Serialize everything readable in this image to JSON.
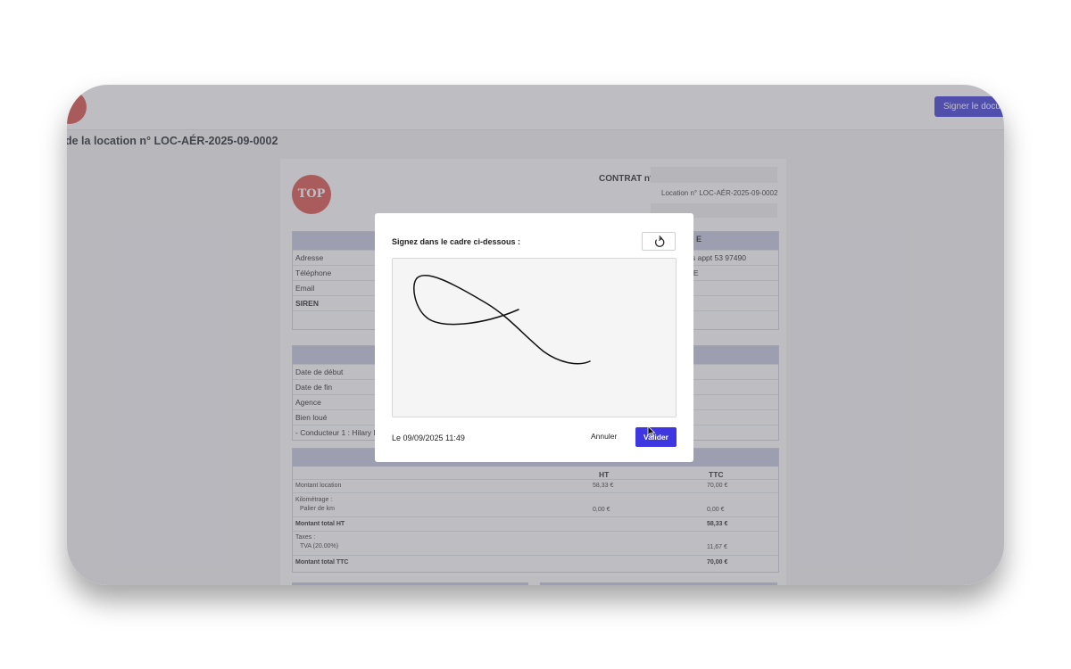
{
  "header": {
    "sign_document_label": "Signer le docu"
  },
  "page": {
    "title": "de la location n° LOC-AÉR-2025-09-0002"
  },
  "document": {
    "logo_text": "TOP",
    "contract_label": "CONTRAT n°",
    "location_ref": "Location n° LOC-AÉR-2025-09-0002",
    "client_head_fragment": "E",
    "company": {
      "rows": [
        {
          "label": "Adresse",
          "value": "ves appt 53 97490"
        },
        {
          "label": "Téléphone",
          "value": "LDE"
        },
        {
          "label": "Email",
          "value": ""
        },
        {
          "label": "SIREN",
          "value": ""
        }
      ]
    },
    "rental": {
      "rows": [
        {
          "label": "Date de début"
        },
        {
          "label": "Date de fin"
        },
        {
          "label": "Agence"
        },
        {
          "label": "Bien loué"
        },
        {
          "label": "- Conducteur 1 : Hilary D"
        }
      ]
    },
    "pricing": {
      "ht_header": "HT",
      "ttc_header": "TTC",
      "rows": [
        {
          "label": "Montant location",
          "ht": "58,33 €",
          "ttc": "70,00 €"
        },
        {
          "label": "Kilométrage :",
          "ht": "",
          "ttc": ""
        },
        {
          "label": "Palier de km",
          "ht": "0,00 €",
          "ttc": "0,00 €"
        },
        {
          "label": "Montant total HT",
          "ht": "",
          "ttc": "58,33 €"
        },
        {
          "label": "Taxes :",
          "ht": "",
          "ttc": ""
        },
        {
          "label": "TVA (20.00%)",
          "ht": "",
          "ttc": "11,67 €"
        },
        {
          "label": "Montant total TTC",
          "ht": "",
          "ttc": "70,00 €"
        }
      ]
    }
  },
  "modal": {
    "instruction": "Signez dans le cadre ci-dessous :",
    "date_text": "Le 09/09/2025 11:49",
    "cancel_label": "Annuler",
    "validate_label": "Valider"
  },
  "icons": {
    "reset": "reset-icon",
    "cursor": "mouse-cursor-icon"
  }
}
